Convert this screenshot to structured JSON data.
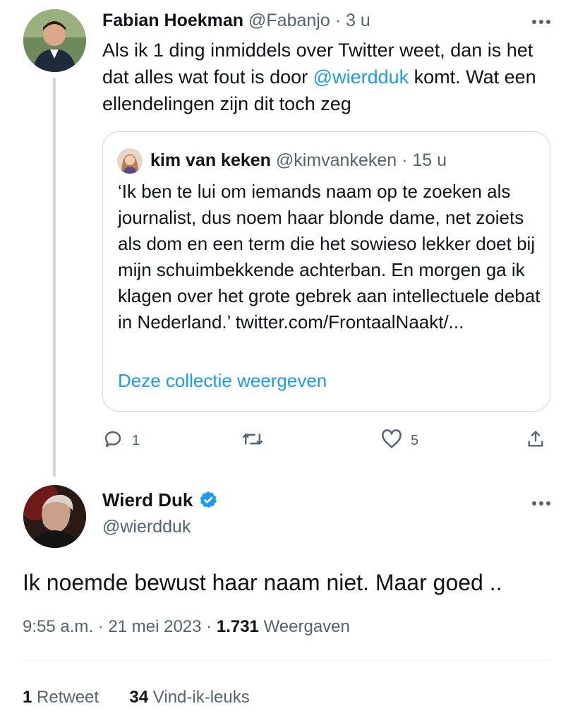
{
  "parent_tweet": {
    "display_name": "Fabian Hoekman",
    "handle": "@Fabanjo",
    "time": "3 u",
    "text_before": "Als ik 1 ding inmiddels over Twitter weet, dan is het dat alles wat fout is door ",
    "mention": "@wierdduk",
    "text_after": " komt. Wat een ellendelingen zijn dit toch zeg",
    "quote": {
      "display_name": "kim van keken",
      "handle": "@kimvankeken",
      "time": "15 u",
      "text": "‘Ik ben te lui om iemands naam op te zoeken als journalist, dus noem haar blonde dame, net zoiets als dom en een term die het sowieso lekker doet bij mijn schuimbekkende achterban. En morgen ga ik klagen over het grote gebrek aan intellectuele debat in Nederland.’ twitter.com/FrontaalNaakt/...",
      "link_label": "Deze collectie weergeven"
    },
    "actions": {
      "reply_count": "1",
      "retweet_count": "",
      "like_count": "5"
    },
    "icons": [
      "reply-icon",
      "retweet-icon",
      "like-icon",
      "share-icon",
      "more-icon"
    ]
  },
  "main_tweet": {
    "display_name": "Wierd Duk",
    "handle": "@wierdduk",
    "verified": true,
    "text": "Ik noemde bewust haar naam niet. Maar goed ..",
    "time": "9:55 a.m.",
    "date": "21 mei 2023",
    "views_count": "1.731",
    "views_label": "Weergaven",
    "retweets_count": "1",
    "retweets_label": "Retweet",
    "likes_count": "34",
    "likes_label": "Vind-ik-leuks"
  },
  "colors": {
    "accent": "#1d9bf0",
    "text_primary": "#0f1419",
    "text_secondary": "#536471",
    "border": "#cfd9de"
  }
}
